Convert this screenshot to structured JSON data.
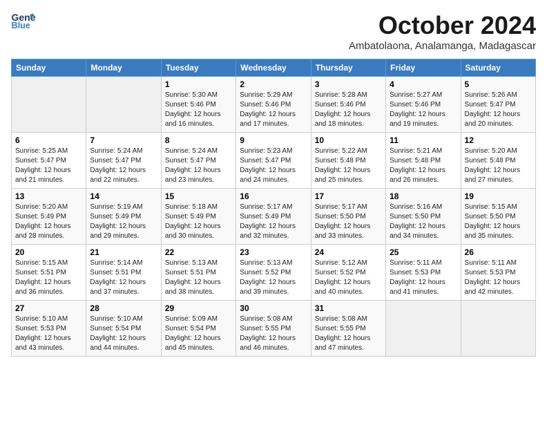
{
  "header": {
    "logo_line1": "General",
    "logo_line2": "Blue",
    "month_title": "October 2024",
    "subtitle": "Ambatolaona, Analamanga, Madagascar"
  },
  "calendar": {
    "days_of_week": [
      "Sunday",
      "Monday",
      "Tuesday",
      "Wednesday",
      "Thursday",
      "Friday",
      "Saturday"
    ],
    "weeks": [
      [
        {
          "day": "",
          "sunrise": "",
          "sunset": "",
          "daylight": ""
        },
        {
          "day": "",
          "sunrise": "",
          "sunset": "",
          "daylight": ""
        },
        {
          "day": "1",
          "sunrise": "Sunrise: 5:30 AM",
          "sunset": "Sunset: 5:46 PM",
          "daylight": "Daylight: 12 hours and 16 minutes."
        },
        {
          "day": "2",
          "sunrise": "Sunrise: 5:29 AM",
          "sunset": "Sunset: 5:46 PM",
          "daylight": "Daylight: 12 hours and 17 minutes."
        },
        {
          "day": "3",
          "sunrise": "Sunrise: 5:28 AM",
          "sunset": "Sunset: 5:46 PM",
          "daylight": "Daylight: 12 hours and 18 minutes."
        },
        {
          "day": "4",
          "sunrise": "Sunrise: 5:27 AM",
          "sunset": "Sunset: 5:46 PM",
          "daylight": "Daylight: 12 hours and 19 minutes."
        },
        {
          "day": "5",
          "sunrise": "Sunrise: 5:26 AM",
          "sunset": "Sunset: 5:47 PM",
          "daylight": "Daylight: 12 hours and 20 minutes."
        }
      ],
      [
        {
          "day": "6",
          "sunrise": "Sunrise: 5:25 AM",
          "sunset": "Sunset: 5:47 PM",
          "daylight": "Daylight: 12 hours and 21 minutes."
        },
        {
          "day": "7",
          "sunrise": "Sunrise: 5:24 AM",
          "sunset": "Sunset: 5:47 PM",
          "daylight": "Daylight: 12 hours and 22 minutes."
        },
        {
          "day": "8",
          "sunrise": "Sunrise: 5:24 AM",
          "sunset": "Sunset: 5:47 PM",
          "daylight": "Daylight: 12 hours and 23 minutes."
        },
        {
          "day": "9",
          "sunrise": "Sunrise: 5:23 AM",
          "sunset": "Sunset: 5:47 PM",
          "daylight": "Daylight: 12 hours and 24 minutes."
        },
        {
          "day": "10",
          "sunrise": "Sunrise: 5:22 AM",
          "sunset": "Sunset: 5:48 PM",
          "daylight": "Daylight: 12 hours and 25 minutes."
        },
        {
          "day": "11",
          "sunrise": "Sunrise: 5:21 AM",
          "sunset": "Sunset: 5:48 PM",
          "daylight": "Daylight: 12 hours and 26 minutes."
        },
        {
          "day": "12",
          "sunrise": "Sunrise: 5:20 AM",
          "sunset": "Sunset: 5:48 PM",
          "daylight": "Daylight: 12 hours and 27 minutes."
        }
      ],
      [
        {
          "day": "13",
          "sunrise": "Sunrise: 5:20 AM",
          "sunset": "Sunset: 5:49 PM",
          "daylight": "Daylight: 12 hours and 28 minutes."
        },
        {
          "day": "14",
          "sunrise": "Sunrise: 5:19 AM",
          "sunset": "Sunset: 5:49 PM",
          "daylight": "Daylight: 12 hours and 29 minutes."
        },
        {
          "day": "15",
          "sunrise": "Sunrise: 5:18 AM",
          "sunset": "Sunset: 5:49 PM",
          "daylight": "Daylight: 12 hours and 30 minutes."
        },
        {
          "day": "16",
          "sunrise": "Sunrise: 5:17 AM",
          "sunset": "Sunset: 5:49 PM",
          "daylight": "Daylight: 12 hours and 32 minutes."
        },
        {
          "day": "17",
          "sunrise": "Sunrise: 5:17 AM",
          "sunset": "Sunset: 5:50 PM",
          "daylight": "Daylight: 12 hours and 33 minutes."
        },
        {
          "day": "18",
          "sunrise": "Sunrise: 5:16 AM",
          "sunset": "Sunset: 5:50 PM",
          "daylight": "Daylight: 12 hours and 34 minutes."
        },
        {
          "day": "19",
          "sunrise": "Sunrise: 5:15 AM",
          "sunset": "Sunset: 5:50 PM",
          "daylight": "Daylight: 12 hours and 35 minutes."
        }
      ],
      [
        {
          "day": "20",
          "sunrise": "Sunrise: 5:15 AM",
          "sunset": "Sunset: 5:51 PM",
          "daylight": "Daylight: 12 hours and 36 minutes."
        },
        {
          "day": "21",
          "sunrise": "Sunrise: 5:14 AM",
          "sunset": "Sunset: 5:51 PM",
          "daylight": "Daylight: 12 hours and 37 minutes."
        },
        {
          "day": "22",
          "sunrise": "Sunrise: 5:13 AM",
          "sunset": "Sunset: 5:51 PM",
          "daylight": "Daylight: 12 hours and 38 minutes."
        },
        {
          "day": "23",
          "sunrise": "Sunrise: 5:13 AM",
          "sunset": "Sunset: 5:52 PM",
          "daylight": "Daylight: 12 hours and 39 minutes."
        },
        {
          "day": "24",
          "sunrise": "Sunrise: 5:12 AM",
          "sunset": "Sunset: 5:52 PM",
          "daylight": "Daylight: 12 hours and 40 minutes."
        },
        {
          "day": "25",
          "sunrise": "Sunrise: 5:11 AM",
          "sunset": "Sunset: 5:53 PM",
          "daylight": "Daylight: 12 hours and 41 minutes."
        },
        {
          "day": "26",
          "sunrise": "Sunrise: 5:11 AM",
          "sunset": "Sunset: 5:53 PM",
          "daylight": "Daylight: 12 hours and 42 minutes."
        }
      ],
      [
        {
          "day": "27",
          "sunrise": "Sunrise: 5:10 AM",
          "sunset": "Sunset: 5:53 PM",
          "daylight": "Daylight: 12 hours and 43 minutes."
        },
        {
          "day": "28",
          "sunrise": "Sunrise: 5:10 AM",
          "sunset": "Sunset: 5:54 PM",
          "daylight": "Daylight: 12 hours and 44 minutes."
        },
        {
          "day": "29",
          "sunrise": "Sunrise: 5:09 AM",
          "sunset": "Sunset: 5:54 PM",
          "daylight": "Daylight: 12 hours and 45 minutes."
        },
        {
          "day": "30",
          "sunrise": "Sunrise: 5:08 AM",
          "sunset": "Sunset: 5:55 PM",
          "daylight": "Daylight: 12 hours and 46 minutes."
        },
        {
          "day": "31",
          "sunrise": "Sunrise: 5:08 AM",
          "sunset": "Sunset: 5:55 PM",
          "daylight": "Daylight: 12 hours and 47 minutes."
        },
        {
          "day": "",
          "sunrise": "",
          "sunset": "",
          "daylight": ""
        },
        {
          "day": "",
          "sunrise": "",
          "sunset": "",
          "daylight": ""
        }
      ]
    ]
  }
}
